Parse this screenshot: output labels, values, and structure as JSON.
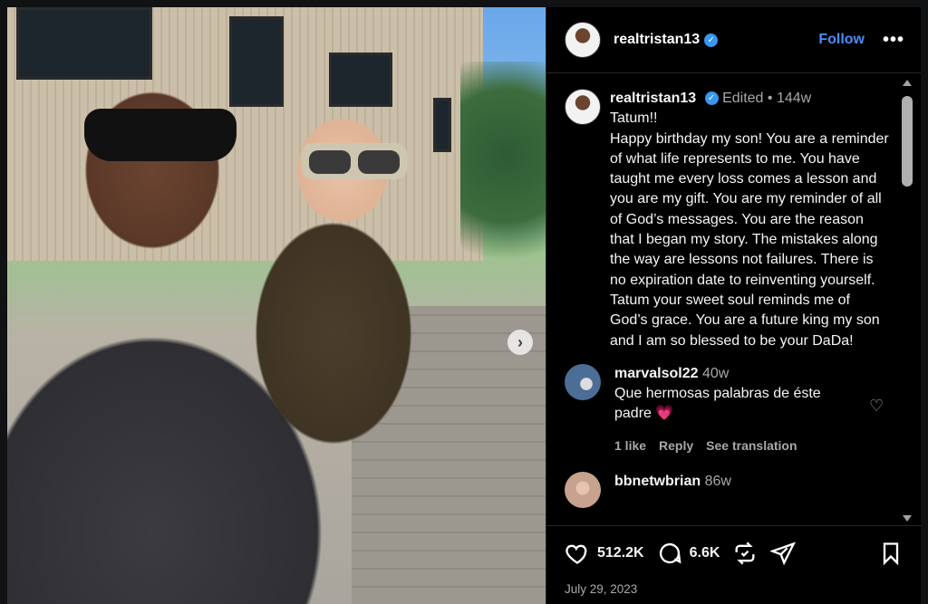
{
  "post": {
    "username": "realtristan13",
    "follow_label": "Follow",
    "more_label": "•••",
    "verified_icon": "✓",
    "caption": {
      "username": "realtristan13",
      "edited": "Edited",
      "separator": "•",
      "age": "144w",
      "text": "Tatum!!\nHappy birthday my son! You are a reminder of what life represents to me. You have taught me every loss comes a lesson and you are my gift. You are my reminder of all of God’s messages. You are the reason that I began my story. The mistakes along the way are lessons not failures. There is no expiration date to reinventing yourself. Tatum your sweet soul reminds me of God’s grace. You are a future king my son and I am so blessed to be your DaDa!"
    },
    "comments": [
      {
        "username": "marvalsol22",
        "age": "40w",
        "text": "Que hermosas palabras de éste padre",
        "emoji": "💗",
        "likes": "1 like",
        "reply": "Reply",
        "translate": "See translation"
      },
      {
        "username": "bbnetwbrian",
        "age": "86w"
      }
    ],
    "like_count": "512.2K",
    "comment_count": "6.6K",
    "date": "July 29, 2023",
    "next_icon": "›"
  },
  "colors": {
    "accent": "#4a8df8",
    "verified": "#3897f0",
    "muted": "#a8a8a8",
    "background": "#000000"
  },
  "icons": [
    "heart-icon",
    "comment-icon",
    "repost-icon",
    "share-icon",
    "bookmark-icon",
    "more-icon",
    "verified-icon",
    "chevron-right-icon"
  ]
}
